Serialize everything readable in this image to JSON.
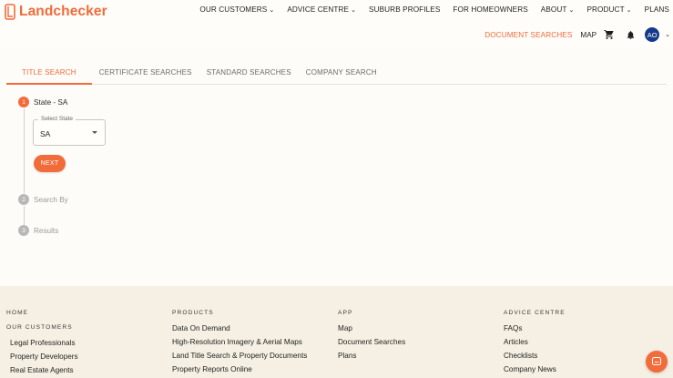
{
  "brand": {
    "name": "Landchecker",
    "color": "#f26b3a"
  },
  "nav": {
    "items": [
      {
        "label": "OUR CUSTOMERS",
        "dropdown": true
      },
      {
        "label": "ADVICE CENTRE",
        "dropdown": true
      },
      {
        "label": "SUBURB PROFILES",
        "dropdown": false
      },
      {
        "label": "FOR HOMEOWNERS",
        "dropdown": false
      },
      {
        "label": "ABOUT",
        "dropdown": true
      },
      {
        "label": "PRODUCT",
        "dropdown": true
      },
      {
        "label": "PLANS",
        "dropdown": false
      }
    ],
    "document_searches": "DOCUMENT SEARCHES",
    "map": "MAP",
    "cart_icon": "cart-icon",
    "bell_icon": "bell-icon",
    "avatar_initials": "AO",
    "avatar_color": "#163a8a"
  },
  "tabs": [
    {
      "label": "TITLE SEARCH",
      "active": true
    },
    {
      "label": "CERTIFICATE SEARCHES",
      "active": false
    },
    {
      "label": "STANDARD SEARCHES",
      "active": false
    },
    {
      "label": "COMPANY SEARCH",
      "active": false
    }
  ],
  "stepper": {
    "steps": [
      {
        "number": "1",
        "label": "State - SA",
        "active": true
      },
      {
        "number": "2",
        "label": "Search By",
        "active": false
      },
      {
        "number": "3",
        "label": "Results",
        "active": false
      }
    ],
    "select": {
      "legend": "Select State",
      "value": "SA"
    },
    "next_label": "NEXT"
  },
  "footer": {
    "col1": {
      "heading": "HOME",
      "subheading": "OUR CUSTOMERS",
      "links": [
        "Legal Professionals",
        "Property Developers",
        "Real Estate Agents"
      ]
    },
    "col2": {
      "heading": "PRODUCTS",
      "links": [
        "Data On Demand",
        "High-Resolution Imagery & Aerial Maps",
        "Land Title Search & Property Documents",
        "Property Reports Online"
      ]
    },
    "col3": {
      "heading": "APP",
      "links": [
        "Map",
        "Document Searches",
        "Plans"
      ]
    },
    "col4": {
      "heading": "ADVICE CENTRE",
      "links": [
        "FAQs",
        "Articles",
        "Checklists",
        "Company News"
      ]
    }
  },
  "chat_icon": "chat-icon"
}
